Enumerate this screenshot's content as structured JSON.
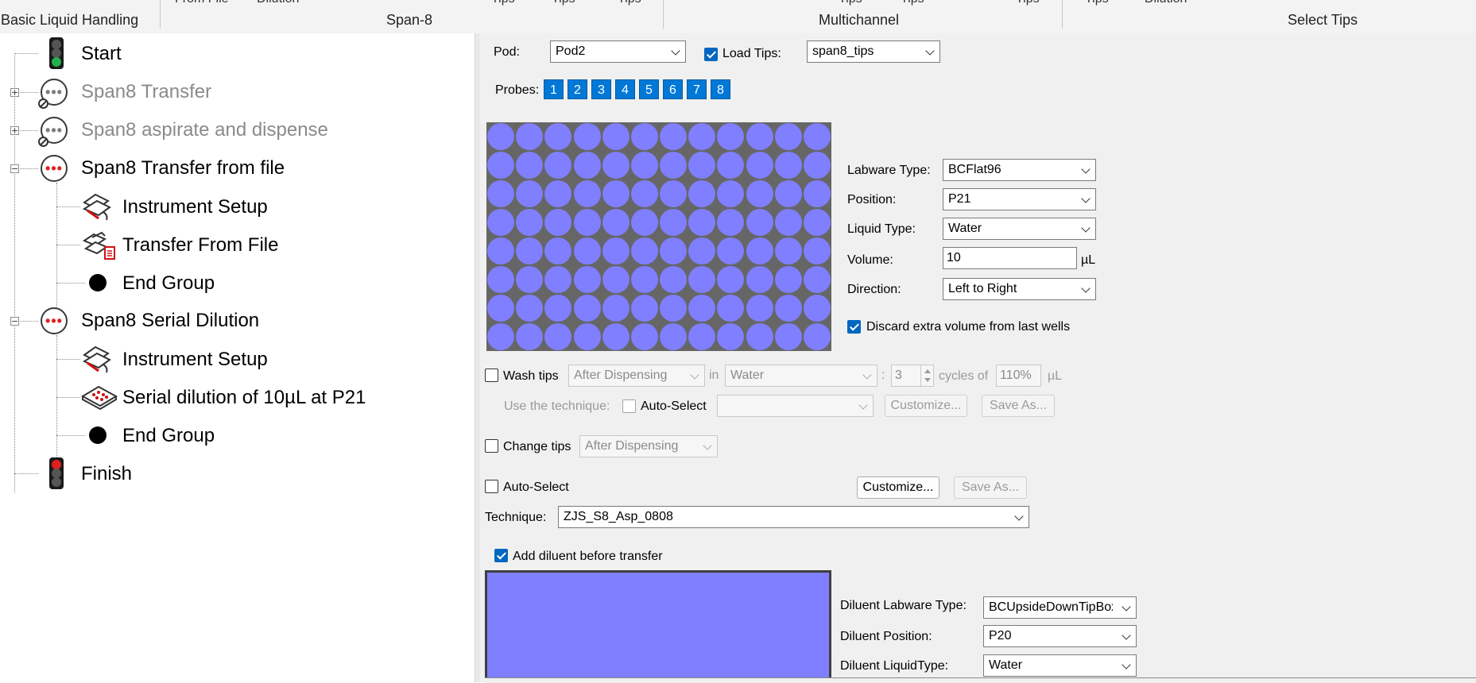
{
  "ribbon": {
    "clipped_texts": [
      "From File",
      "Dilution",
      "Tips",
      "Tips",
      "Tips",
      "Tips",
      "Tips",
      "Tips",
      "Tips",
      "Dilution"
    ],
    "groups": [
      "Basic Liquid Handling",
      "Span-8",
      "Multichannel",
      "Select Tips"
    ]
  },
  "tree": {
    "items": [
      {
        "label": "Start",
        "icon": "traffic-light-green-icon"
      },
      {
        "label": "Span8 Transfer",
        "icon": "group-disabled-icon",
        "expander": "+"
      },
      {
        "label": "Span8 aspirate and dispense",
        "icon": "group-disabled-icon",
        "expander": "+"
      },
      {
        "label": "Span8 Transfer from file",
        "icon": "group-icon",
        "expander": "−"
      },
      {
        "label": "Instrument Setup",
        "icon": "instrument-setup-icon"
      },
      {
        "label": "Transfer From File",
        "icon": "transfer-from-file-icon"
      },
      {
        "label": "End Group",
        "icon": "end-group-icon"
      },
      {
        "label": "Span8 Serial Dilution",
        "icon": "group-icon",
        "expander": "−"
      },
      {
        "label": "Instrument Setup",
        "icon": "instrument-setup-icon"
      },
      {
        "label": "Serial dilution of 10µL at P21",
        "icon": "serial-dilution-icon"
      },
      {
        "label": "End Group",
        "icon": "end-group-icon"
      },
      {
        "label": "Finish",
        "icon": "traffic-light-red-icon"
      }
    ]
  },
  "panel": {
    "pod": {
      "label": "Pod:",
      "value": "Pod2"
    },
    "load_tips": {
      "label": "Load Tips:",
      "checked": true,
      "value": "span8_tips"
    },
    "probes": {
      "label": "Probes:",
      "items": [
        "1",
        "2",
        "3",
        "4",
        "5",
        "6",
        "7",
        "8"
      ],
      "color": "#0078d7"
    },
    "plate": {
      "rows": 8,
      "cols": 12,
      "well_color": "#7f7fff",
      "background": "#666666"
    },
    "labware_type": {
      "label": "Labware Type:",
      "value": "BCFlat96"
    },
    "position": {
      "label": "Position:",
      "value": "P21"
    },
    "liquid_type": {
      "label": "Liquid Type:",
      "value": "Water"
    },
    "volume": {
      "label": "Volume:",
      "value": "10",
      "unit": "µL"
    },
    "direction": {
      "label": "Direction:",
      "value": "Left to Right"
    },
    "discard": {
      "label": "Discard extra volume from last wells",
      "checked": true
    },
    "wash": {
      "label": "Wash tips",
      "checked": false,
      "when": "After Dispensing",
      "in_label": "in",
      "liquid": "Water",
      "colon": ":",
      "cycles": "3",
      "cycles_label": "cycles of",
      "percent": "110%",
      "unit": "µL",
      "technique_label": "Use the technique:",
      "auto_select_label": "Auto-Select",
      "technique_value": "",
      "customize": "Customize...",
      "save_as": "Save As..."
    },
    "change_tips": {
      "label": "Change tips",
      "checked": false,
      "when": "After Dispensing"
    },
    "technique": {
      "auto_select_label": "Auto-Select",
      "auto_select_checked": false,
      "customize": "Customize...",
      "save_as": "Save As...",
      "label": "Technique:",
      "value": "ZJS_S8_Asp_0808"
    },
    "add_diluent": {
      "label": "Add diluent before transfer",
      "checked": true
    },
    "diluent": {
      "color": "#7f7fff",
      "labware_type": {
        "label": "Diluent Labware Type:",
        "value": "BCUpsideDownTipBox"
      },
      "position": {
        "label": "Diluent Position:",
        "value": "P20"
      },
      "liquid_type": {
        "label": "Diluent LiquidType:",
        "value": "Water"
      }
    }
  }
}
